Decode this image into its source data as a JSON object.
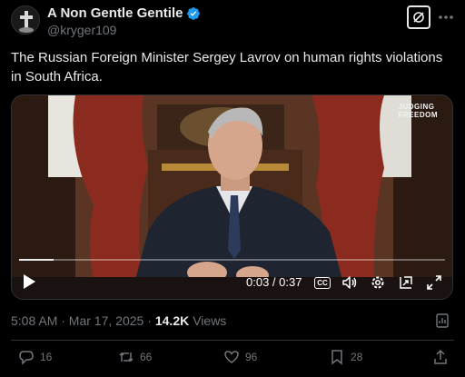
{
  "author": {
    "display_name": "A Non Gentle Gentile",
    "handle": "@kryger109"
  },
  "tweet": {
    "text": "The Russian Foreign Minister Sergey Lavrov on human rights violations in South Africa."
  },
  "video": {
    "watermark_line1": "JUDGING",
    "watermark_line2": "FREEDOM",
    "time_display": "0:03 / 0:37",
    "cc_label": "CC",
    "progress": 0.08
  },
  "meta": {
    "timestamp": "5:08 AM · Mar 17, 2025 · ",
    "views_count": "14.2K",
    "views_label": "Views"
  },
  "actions": {
    "replies": "16",
    "reposts": "66",
    "likes": "96",
    "bookmarks": "28"
  },
  "colors": {
    "background": "#000000",
    "text": "#e7e9ea",
    "muted": "#71767b",
    "verified": "#1d9bf0",
    "border": "#2f3336"
  }
}
